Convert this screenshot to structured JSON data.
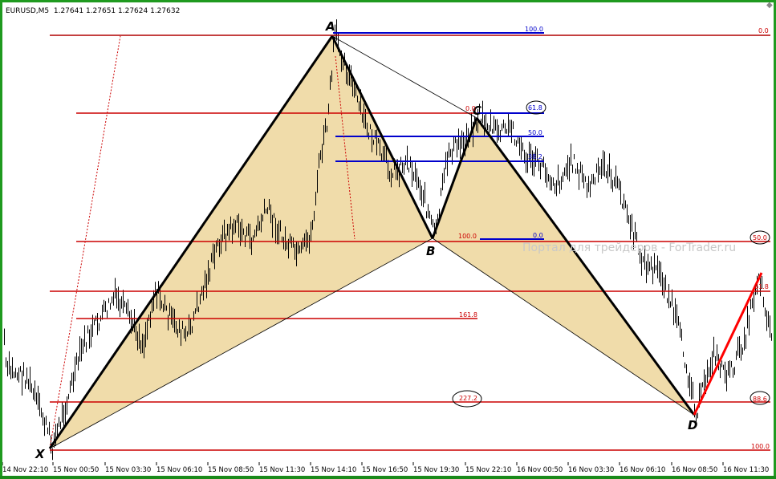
{
  "header": {
    "symbol": "EURUSD,M5",
    "ohlc": "1.27641 1.27651 1.27624 1.27632"
  },
  "watermark": "Портал для трейдеров - ForTrader.ru",
  "chart_data": {
    "type": "line",
    "title": "EURUSD,M5",
    "x_tick_labels": [
      "14 Nov 22:10",
      "15 Nov 00:50",
      "15 Nov 03:30",
      "15 Nov 06:10",
      "15 Nov 08:50",
      "15 Nov 11:30",
      "15 Nov 14:10",
      "15 Nov 16:50",
      "15 Nov 19:30",
      "15 Nov 22:10",
      "16 Nov 00:50",
      "16 Nov 03:30",
      "16 Nov 06:10",
      "16 Nov 08:50",
      "16 Nov 11:30"
    ],
    "pattern_points": [
      {
        "label": "X",
        "time": "14 Nov 23:05"
      },
      {
        "label": "A",
        "time": "15 Nov 14:10"
      },
      {
        "label": "B",
        "time": "15 Nov 19:10"
      },
      {
        "label": "C",
        "time": "15 Nov 21:40"
      },
      {
        "label": "D",
        "time": "16 Nov 08:40"
      }
    ],
    "fib_labels": {
      "right_red": [
        "0.0",
        "50.0",
        "61.8",
        "88.6",
        "100.0"
      ],
      "xa_mid_red": [
        "0.0",
        "100.0",
        "161.8",
        "227.2"
      ],
      "ab_blue": [
        "100.0",
        "61.8",
        "50.0",
        "38.2",
        "0.0"
      ]
    },
    "colors": {
      "frame": "#1f9a1f",
      "fib_red": "#cc0000",
      "fib_blue": "#0000cc",
      "fill": "#f0dcaa",
      "pattern": "#000000",
      "projection": "#ff0000"
    }
  }
}
